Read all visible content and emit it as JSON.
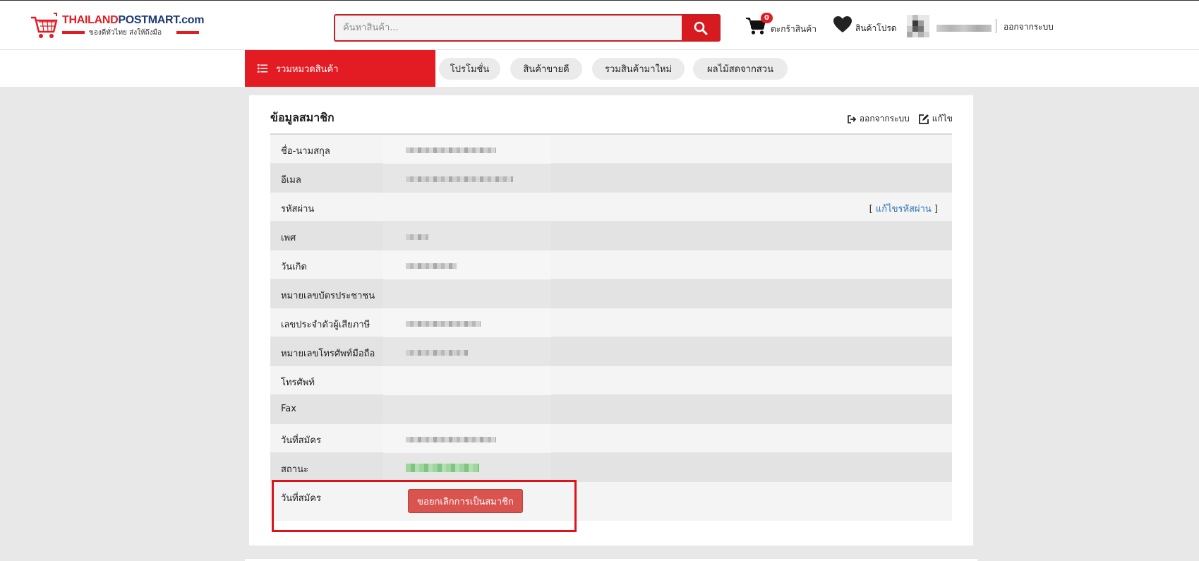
{
  "header": {
    "logo": {
      "brand_red": "THAILAND",
      "brand_navy": "POSTMART.com",
      "tagline": "ของดีทั่วไทย ส่งให้ถึงมือ"
    },
    "search": {
      "placeholder": "ค้นหาสินค้า..."
    },
    "cart": {
      "count": "0",
      "label": "ตะกร้าสินค้า"
    },
    "favorites": {
      "label": "สินค้าโปรด"
    },
    "logout_label": "ออกจากระบบ"
  },
  "nav": {
    "categories_label": "รวมหมวดสินค้า",
    "pills": [
      "โปรโมชั่น",
      "สินค้าขายดี",
      "รวมสินค้ามาใหม่",
      "ผลไม้สดจากสวน"
    ]
  },
  "profile": {
    "title": "ข้อมูลสมาชิก",
    "actions": {
      "logout": "ออกจากระบบ",
      "edit": "แก้ไข"
    },
    "rows": [
      {
        "label": "ชื่อ-นามสกุล"
      },
      {
        "label": "อีเมล"
      },
      {
        "label": "รหัสผ่าน",
        "link_prefix": "[ ",
        "link": "แก้ไขรหัสผ่าน",
        "link_suffix": " ]"
      },
      {
        "label": "เพศ"
      },
      {
        "label": "วันเกิด"
      },
      {
        "label": "หมายเลขบัตรประชาชน"
      },
      {
        "label": "เลขประจำตัวผู้เสียภาษี"
      },
      {
        "label": "หมายเลขโทรศัพท์มือถือ"
      },
      {
        "label": "โทรศัพท์"
      },
      {
        "label": "Fax"
      },
      {
        "label": "วันที่สมัคร"
      },
      {
        "label": "สถานะ"
      }
    ],
    "last_row": {
      "label": "วันที่สมัคร",
      "button": "ขอยกเลิกการเป็นสมาชิก"
    }
  },
  "colors": {
    "brand_red": "#e31b23",
    "brand_navy": "#1d3a72",
    "link_blue": "#2f72b5",
    "cancel_red": "#d9534f"
  }
}
